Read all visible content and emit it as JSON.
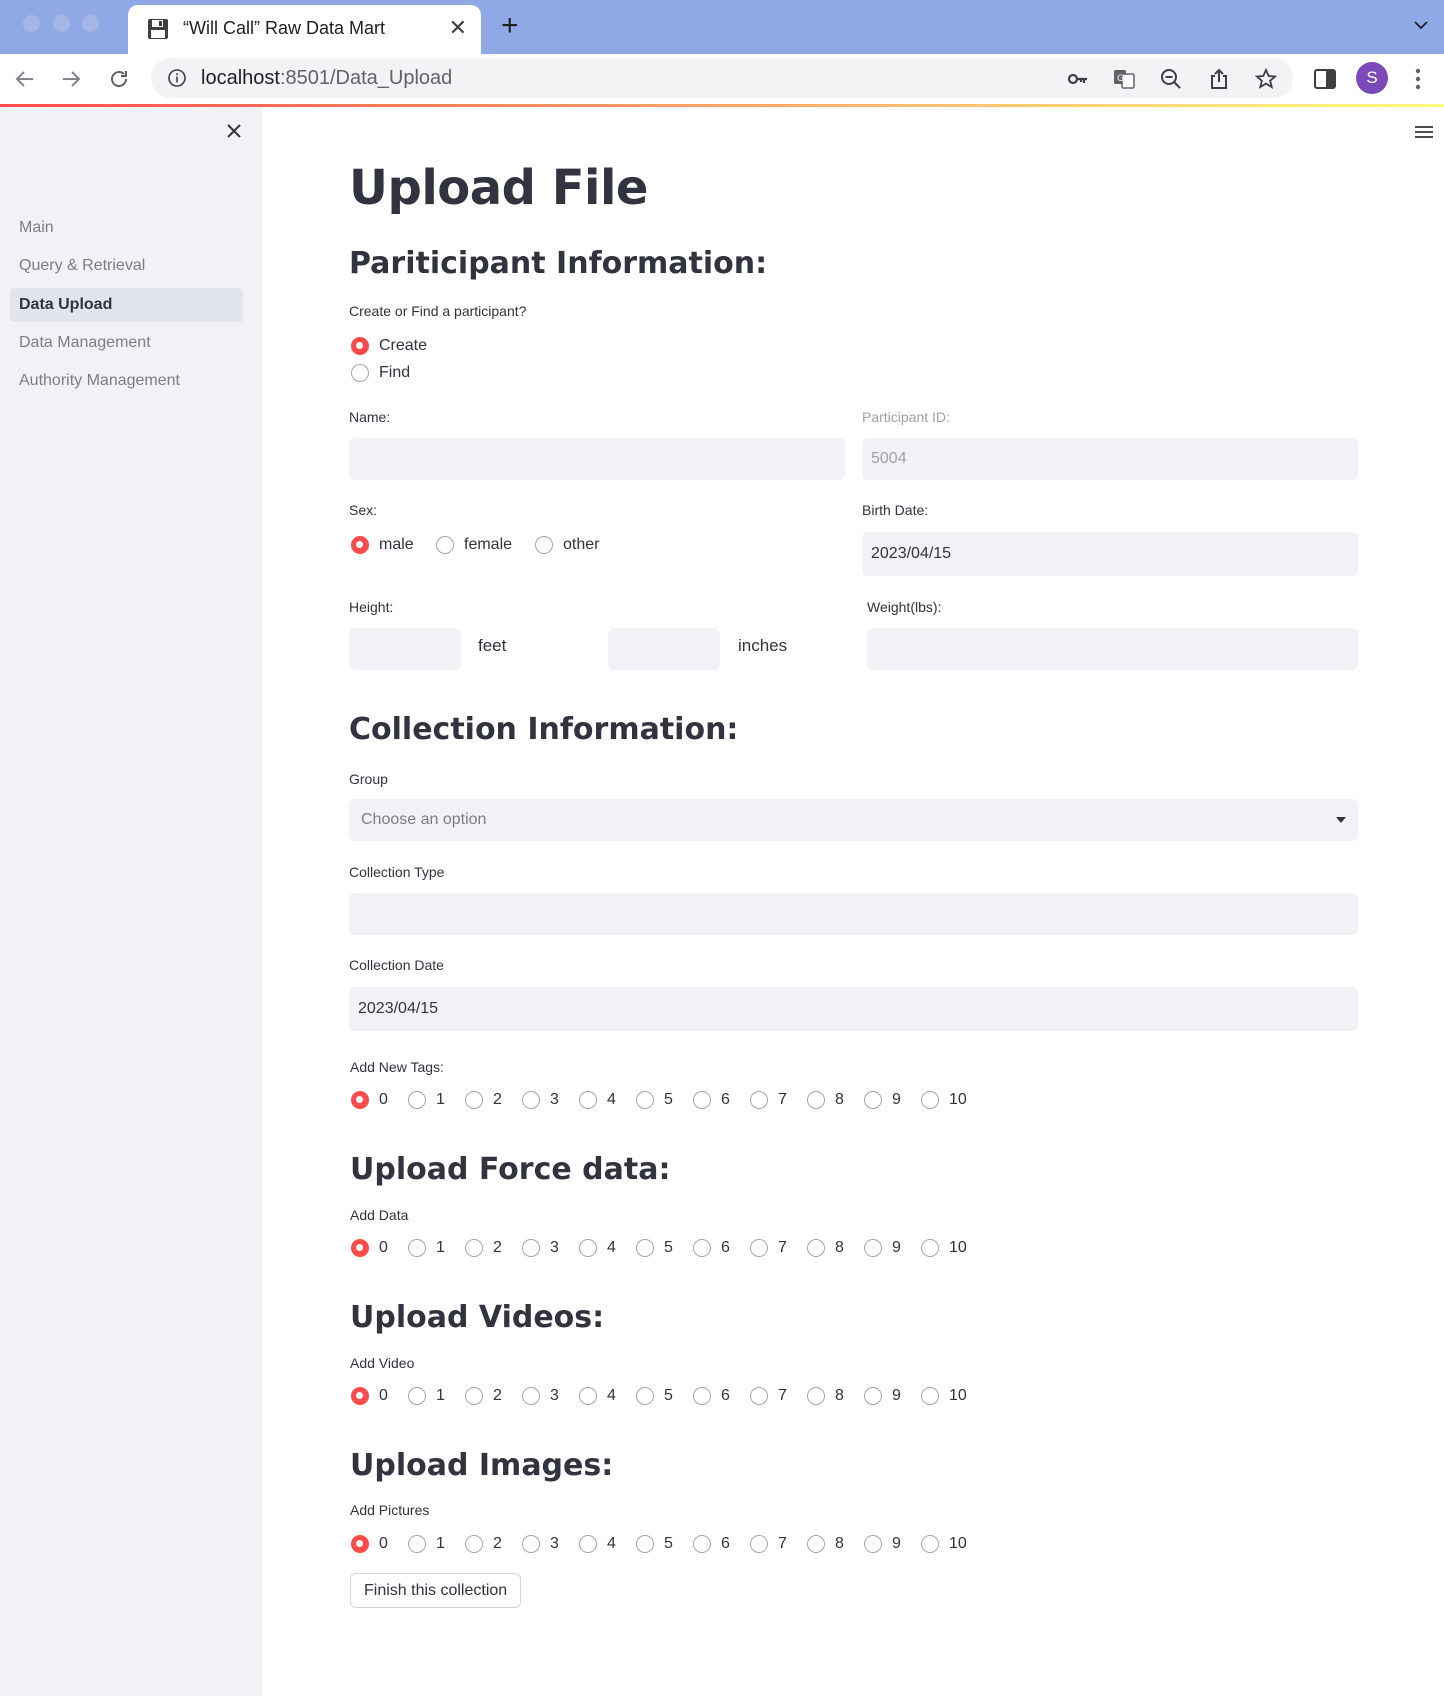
{
  "browser": {
    "tab_title": "“Will Call” Raw Data Mart",
    "url_host": "localhost",
    "url_path": ":8501/Data_Upload",
    "profile_initial": "S"
  },
  "sidebar": {
    "items": [
      {
        "label": "Main"
      },
      {
        "label": "Query & Retrieval"
      },
      {
        "label": "Data Upload"
      },
      {
        "label": "Data Management"
      },
      {
        "label": "Authority Management"
      }
    ],
    "active_index": 2
  },
  "page": {
    "title": "Upload File",
    "participant": {
      "heading": "Pariticipant Information:",
      "mode_label": "Create or Find a participant?",
      "mode_options": [
        "Create",
        "Find"
      ],
      "mode_selected": "Create",
      "name_label": "Name:",
      "name_value": "",
      "id_label": "Participant ID:",
      "id_value": "5004",
      "sex_label": "Sex:",
      "sex_options": [
        "male",
        "female",
        "other"
      ],
      "sex_selected": "male",
      "birth_label": "Birth Date:",
      "birth_value": "2023/04/15",
      "height_label": "Height:",
      "feet_unit": "feet",
      "inches_unit": "inches",
      "weight_label": "Weight(lbs):"
    },
    "collection": {
      "heading": "Collection Information:",
      "group_label": "Group",
      "group_placeholder": "Choose an option",
      "type_label": "Collection Type",
      "date_label": "Collection Date",
      "date_value": "2023/04/15",
      "tags_label": "Add New Tags:"
    },
    "force": {
      "heading": "Upload Force data:",
      "label": "Add Data"
    },
    "videos": {
      "heading": "Upload Videos:",
      "label": "Add Video"
    },
    "images": {
      "heading": "Upload Images:",
      "label": "Add Pictures"
    },
    "count_options": [
      "0",
      "1",
      "2",
      "3",
      "4",
      "5",
      "6",
      "7",
      "8",
      "9",
      "10"
    ],
    "count_selected": "0",
    "finish_button": "Finish this collection"
  },
  "colors": {
    "accent": "#ff4b4b",
    "sidebar_bg": "#f0f2f6",
    "tab_strip": "#8fa9e6"
  }
}
